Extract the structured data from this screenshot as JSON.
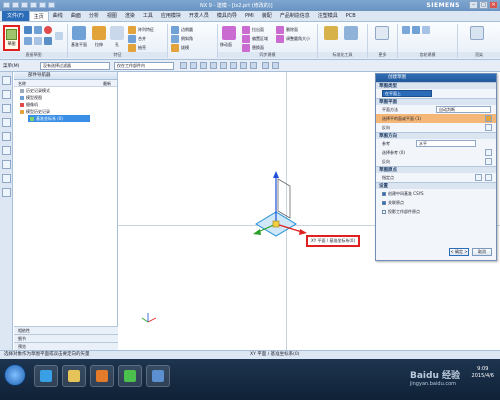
{
  "titlebar": {
    "left_label": "文件(F)",
    "title": "NX 9 - 建模 - [lx2.prt  (修改的)]",
    "brand": "SIEMENS",
    "min": "–",
    "max": "□",
    "close": "✕"
  },
  "menu": {
    "file": "文件(F)",
    "tabs": [
      "主页",
      "曲线",
      "曲面",
      "分析",
      "视图",
      "渲染",
      "工具",
      "应用模块",
      "开发人员",
      "模具向导",
      "PMI",
      "装配",
      "产品制造信息",
      "注塑模具",
      "PCB"
    ],
    "active_tab": 0
  },
  "ribbon": {
    "sketch_label": "草图",
    "group_direct_sketch": "直接草图",
    "group_features": "特征",
    "group_sync": "同步建模",
    "group_standard": "标准化工具",
    "group_more": "更多",
    "group_gear": "齿轮建模",
    "group_render": "渲染",
    "labels": {
      "datum_plane": "基准平面",
      "extrude": "拉伸",
      "hole": "孔",
      "pattern_feature": "阵列特征",
      "unite": "合并",
      "shell": "抽壳",
      "edge_blend": "边倒圆",
      "chamfer": "倒斜角",
      "draft": "拔模",
      "move_face": "移动面",
      "pull_face": "拉出面",
      "offset_region": "偏置区域",
      "replace_face": "替换面",
      "delete_face": "删除面",
      "resize_blend": "调整圆角大小"
    }
  },
  "toolbar": {
    "menu": "菜单(M)",
    "filter": "没有选择过滤器",
    "scope": "仅在工作部件内"
  },
  "navigator": {
    "title": "部件导航器",
    "col_name": "名称",
    "col_latest": "最新",
    "rows": [
      {
        "label": "历史记录模式"
      },
      {
        "label": "模型视图"
      },
      {
        "label": "摄像机"
      },
      {
        "label": "模型历史记录"
      },
      {
        "label": "基准坐标系 (0)"
      }
    ],
    "bottom": [
      "相依性",
      "细节",
      "预览"
    ]
  },
  "viewport": {
    "callout": "XY 平面 / 基准坐标系(0)"
  },
  "dialog": {
    "title": "创建草图",
    "sec_type": "草图类型",
    "type_value": "在平面上",
    "sec_plane": "草图平面",
    "plane_method_label": "平面方法",
    "plane_method_value": "自动判断",
    "select_plane": "选择平的面或平面 (1)",
    "reverse": "反向",
    "sec_direction": "草图方向",
    "reference_label": "参考",
    "reference_value": "水平",
    "select_ref": "选择参考 (0)",
    "reverse2": "反向",
    "sec_origin": "草图原点",
    "specify_point": "指定点",
    "sec_settings": "设置",
    "cb1": "创建中间基准 CSYS",
    "cb2": "关联原点",
    "cb3": "投影工作部件原点",
    "ok": "< 确定 >",
    "cancel": "取消"
  },
  "status": {
    "left": "选择对象作为草图平面或双击要定向的矢量",
    "mid": "XY 平面 / 基准坐标系(0)"
  },
  "taskbar": {
    "time": "9:09",
    "date": "2015/4/6",
    "watermark": "Baidu 经验",
    "watermark_url": "jingyan.baidu.com"
  },
  "colors": {
    "accent": "#2b6cb8",
    "highlight": "#f4b777",
    "callout_border": "#e02020"
  }
}
